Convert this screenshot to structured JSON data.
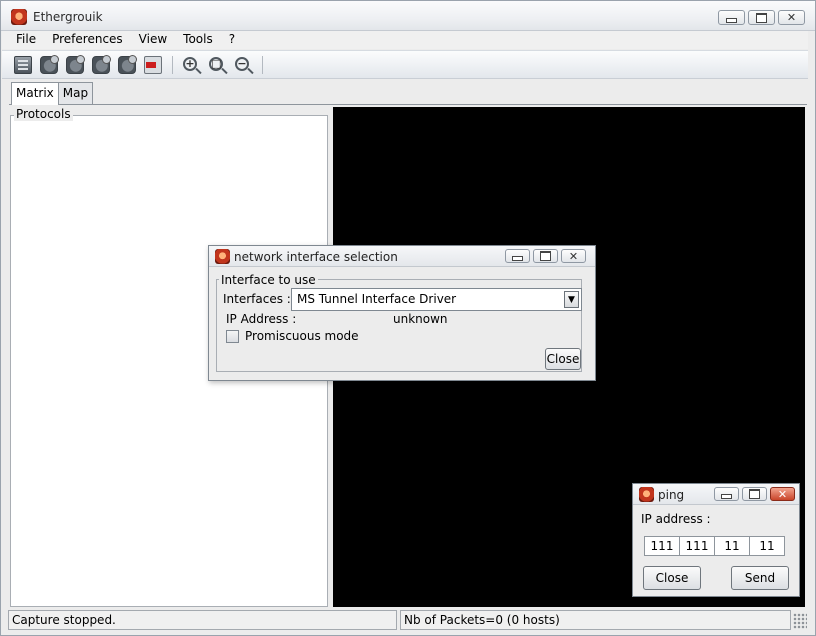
{
  "window": {
    "title": "Ethergrouik"
  },
  "menu": [
    "File",
    "Preferences",
    "View",
    "Tools",
    "?"
  ],
  "toolbar": {
    "buttons": [
      {
        "name": "open-capture",
        "icon": "document-icon"
      },
      {
        "name": "start-capture",
        "icon": "capture-start-icon"
      },
      {
        "name": "pause-capture",
        "icon": "capture-pause-icon"
      },
      {
        "name": "stop-capture",
        "icon": "capture-stop-icon"
      },
      {
        "name": "clear-capture",
        "icon": "capture-clear-icon"
      },
      {
        "name": "exit",
        "icon": "exit-icon"
      },
      {
        "name": "zoom-in",
        "icon": "zoom-in-icon"
      },
      {
        "name": "zoom-fit",
        "icon": "zoom-fit-icon"
      },
      {
        "name": "zoom-out",
        "icon": "zoom-out-icon"
      }
    ]
  },
  "tabs": [
    "Matrix",
    "Map"
  ],
  "active_tab": "Matrix",
  "protocols": {
    "legend": "Protocols"
  },
  "status": {
    "left": "Capture stopped.",
    "right": "Nb of Packets=0 (0 hosts)"
  },
  "nic_dialog": {
    "title": "network interface selection",
    "group_label": "Interface to use",
    "interfaces_label": "Interfaces :",
    "interface_value": "MS Tunnel Interface Driver",
    "ip_label": "IP Address :",
    "ip_value": "unknown",
    "promiscuous_label": "Promiscuous mode",
    "promiscuous_checked": false,
    "close_label": "Close"
  },
  "ping_dialog": {
    "title": "ping",
    "ip_label": "IP address :",
    "octets": [
      "111",
      "111",
      "11",
      "11"
    ],
    "close_label": "Close",
    "send_label": "Send"
  },
  "colors": {
    "canvas": "#000000",
    "close_button": "#c9452a"
  }
}
